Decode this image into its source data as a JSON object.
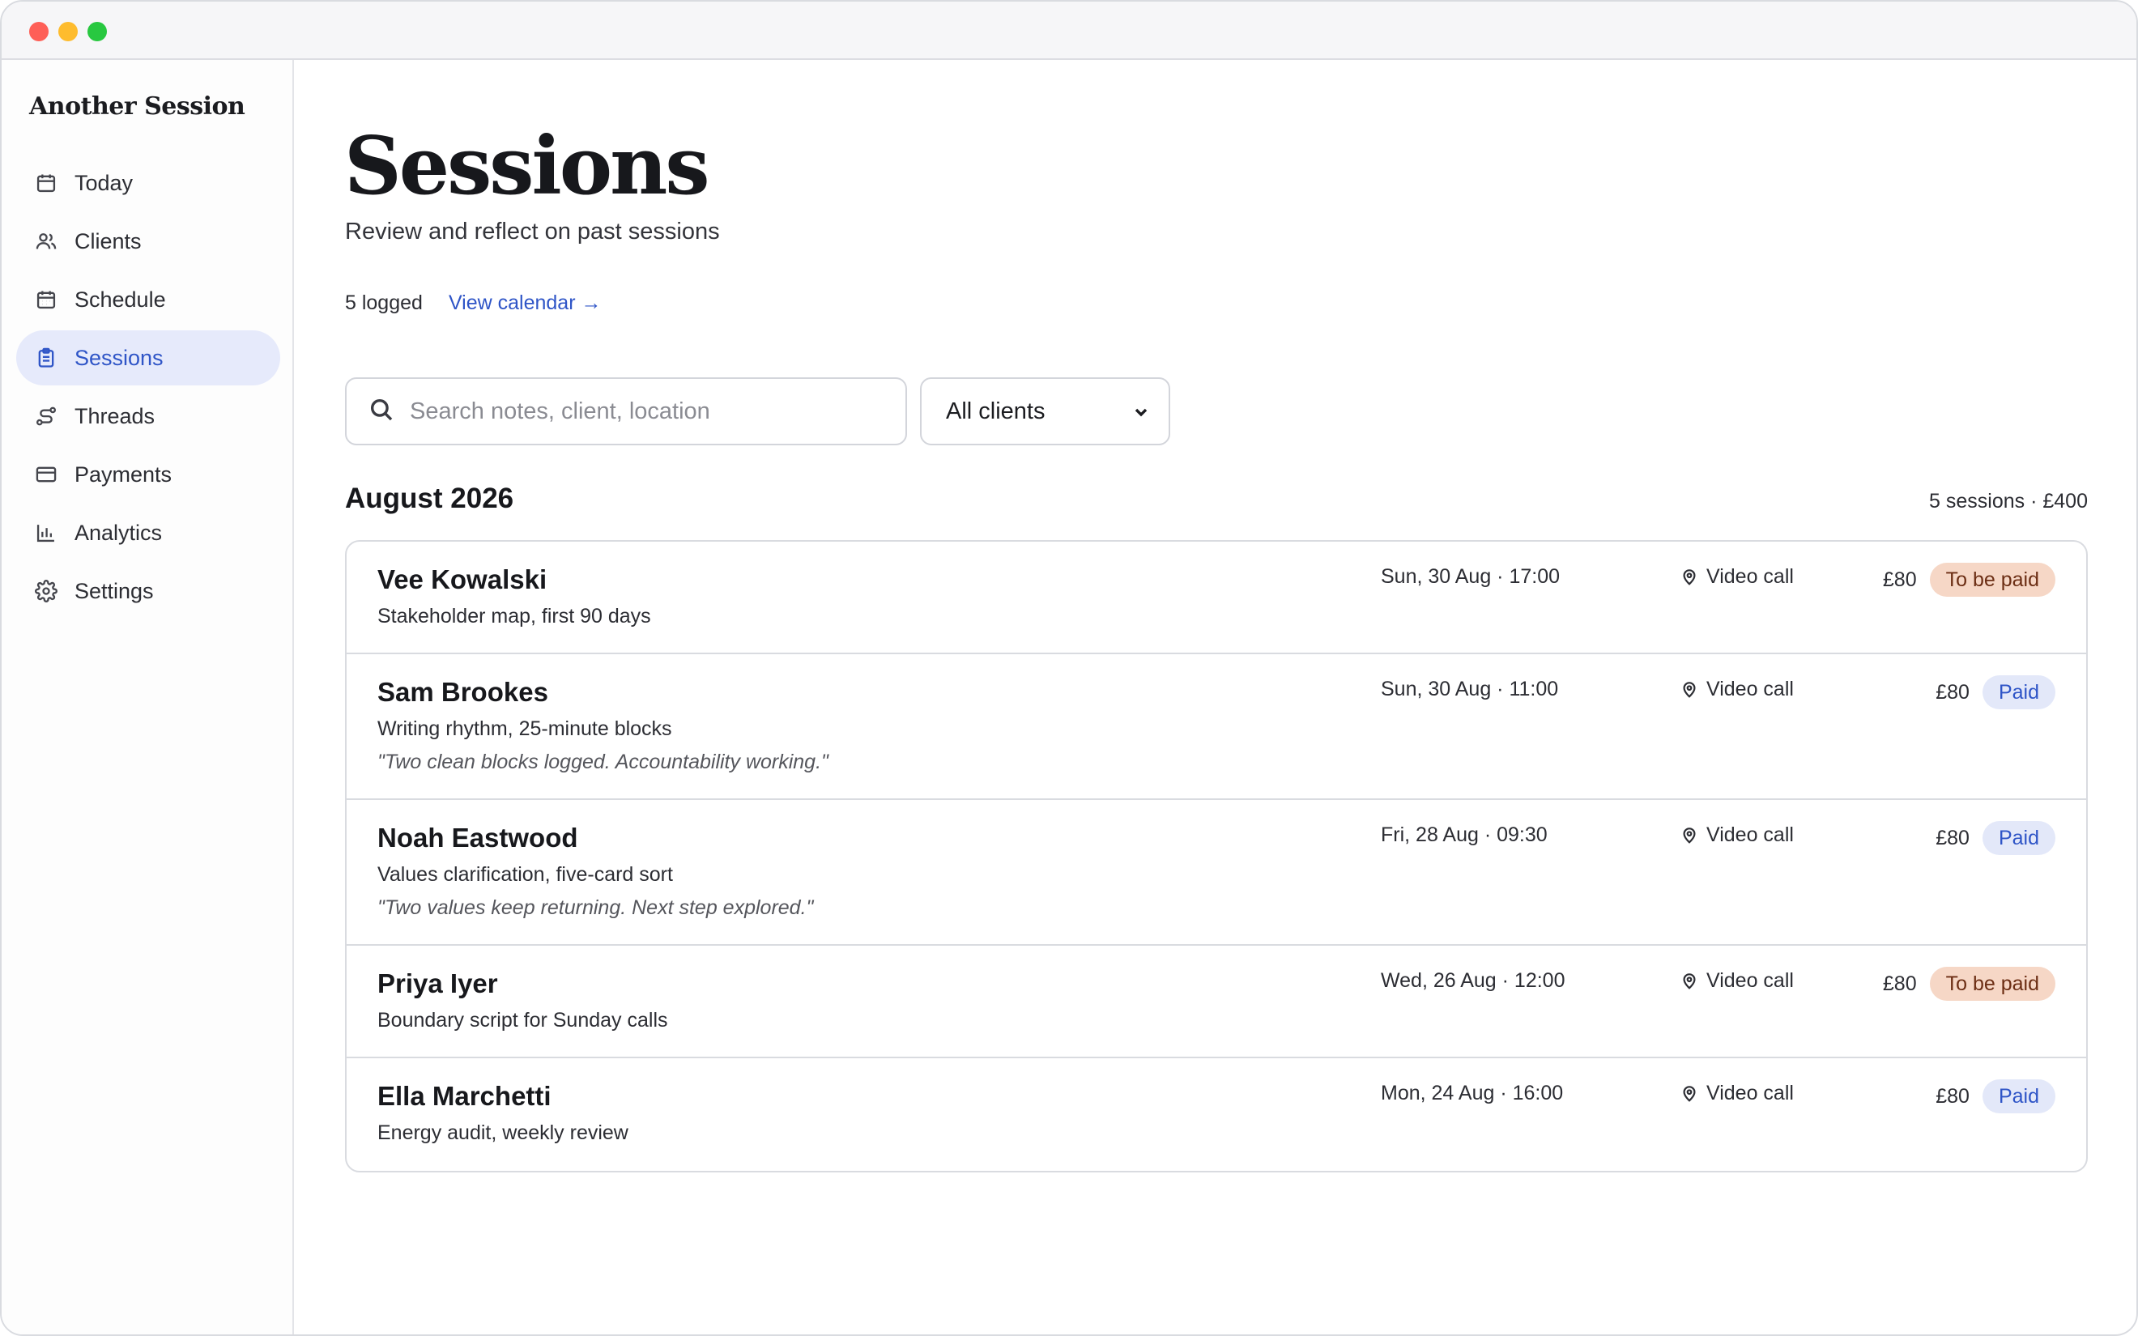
{
  "app": {
    "brand": "Another Session"
  },
  "sidebar": {
    "items": [
      {
        "label": "Today",
        "icon": "calendar-icon",
        "active": false
      },
      {
        "label": "Clients",
        "icon": "users-icon",
        "active": false
      },
      {
        "label": "Schedule",
        "icon": "calendar-grid-icon",
        "active": false
      },
      {
        "label": "Sessions",
        "icon": "clipboard-icon",
        "active": true
      },
      {
        "label": "Threads",
        "icon": "route-icon",
        "active": false
      },
      {
        "label": "Payments",
        "icon": "card-icon",
        "active": false
      },
      {
        "label": "Analytics",
        "icon": "bar-chart-icon",
        "active": false
      },
      {
        "label": "Settings",
        "icon": "gear-icon",
        "active": false
      }
    ]
  },
  "page": {
    "title": "Sessions",
    "subtitle": "Review and reflect on past sessions",
    "logged_count": "5 logged",
    "view_calendar": "View calendar →"
  },
  "filters": {
    "search_placeholder": "Search notes, client, location",
    "search_value": "",
    "client_filter": "All clients"
  },
  "month_group": {
    "heading": "August 2026",
    "summary": "5 sessions · £400"
  },
  "sessions": [
    {
      "client": "Vee Kowalski",
      "topic": "Stakeholder map, first 90 days",
      "reflection": "",
      "when": "Sun, 30 Aug · 17:00",
      "location": "Video call",
      "amount": "£80",
      "status": "To be paid",
      "paid": false
    },
    {
      "client": "Sam Brookes",
      "topic": "Writing rhythm, 25-minute blocks",
      "reflection": "\"Two clean blocks logged. Accountability working.\"",
      "when": "Sun, 30 Aug · 11:00",
      "location": "Video call",
      "amount": "£80",
      "status": "Paid",
      "paid": true
    },
    {
      "client": "Noah Eastwood",
      "topic": "Values clarification, five-card sort",
      "reflection": "\"Two values keep returning. Next step explored.\"",
      "when": "Fri, 28 Aug · 09:30",
      "location": "Video call",
      "amount": "£80",
      "status": "Paid",
      "paid": true
    },
    {
      "client": "Priya Iyer",
      "topic": "Boundary script for Sunday calls",
      "reflection": "",
      "when": "Wed, 26 Aug · 12:00",
      "location": "Video call",
      "amount": "£80",
      "status": "To be paid",
      "paid": false
    },
    {
      "client": "Ella Marchetti",
      "topic": "Energy audit, weekly review",
      "reflection": "",
      "when": "Mon, 24 Aug · 16:00",
      "location": "Video call",
      "amount": "£80",
      "status": "Paid",
      "paid": true
    }
  ],
  "colors": {
    "accent": "#2f55c7",
    "active_nav_bg": "#e6eafb",
    "unpaid_badge_bg": "#f6d7c6",
    "paid_badge_bg": "#e3e8f9"
  }
}
